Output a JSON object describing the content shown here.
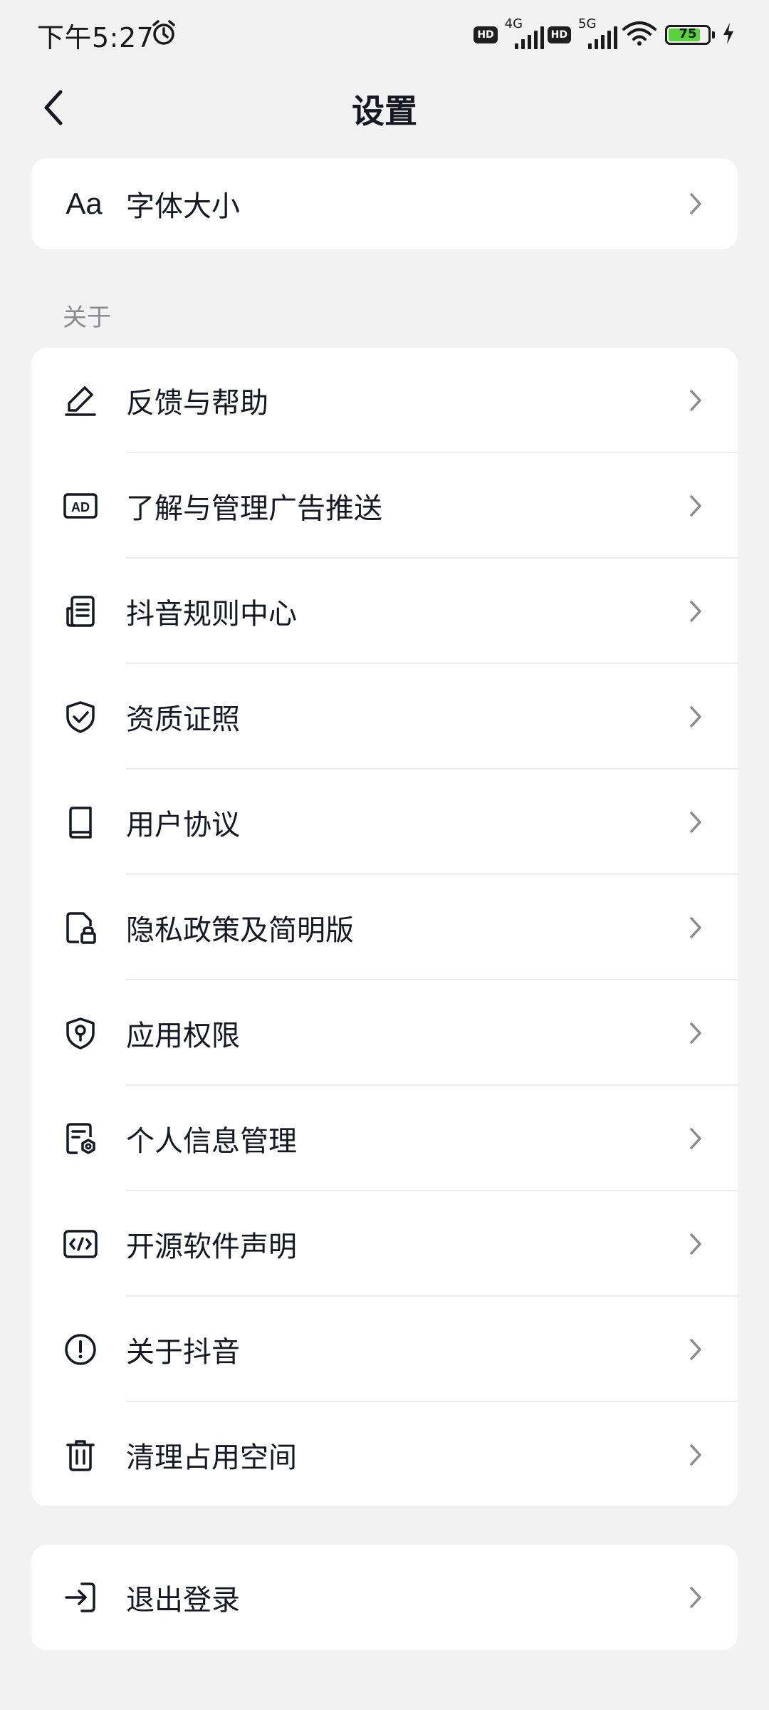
{
  "status_bar": {
    "time": "下午5:27",
    "hd_badge_1": "HD",
    "network_1": "4G",
    "hd_badge_2": "HD",
    "network_2": "5G",
    "battery_level": "75"
  },
  "header": {
    "title": "设置"
  },
  "display_section": {
    "items": [
      {
        "icon": "font-size-icon",
        "icon_text": "Aa",
        "label": "字体大小"
      }
    ]
  },
  "about_section": {
    "title": "关于",
    "items": [
      {
        "icon": "pencil-icon",
        "label": "反馈与帮助"
      },
      {
        "icon": "ad-icon",
        "label": "了解与管理广告推送"
      },
      {
        "icon": "document-list-icon",
        "label": "抖音规则中心"
      },
      {
        "icon": "shield-check-icon",
        "label": "资质证照"
      },
      {
        "icon": "book-icon",
        "label": "用户协议"
      },
      {
        "icon": "file-lock-icon",
        "label": "隐私政策及简明版"
      },
      {
        "icon": "shield-key-icon",
        "label": "应用权限"
      },
      {
        "icon": "file-settings-icon",
        "label": "个人信息管理"
      },
      {
        "icon": "code-icon",
        "label": "开源软件声明"
      },
      {
        "icon": "info-circle-icon",
        "label": "关于抖音"
      },
      {
        "icon": "trash-icon",
        "label": "清理占用空间"
      }
    ]
  },
  "account_section": {
    "items": [
      {
        "icon": "logout-icon",
        "label": "退出登录"
      }
    ]
  },
  "colors": {
    "background": "#f2f2f2",
    "card": "#ffffff",
    "text": "#161823",
    "secondary_text": "#8a8b91",
    "battery_fill": "#5ad13d"
  }
}
